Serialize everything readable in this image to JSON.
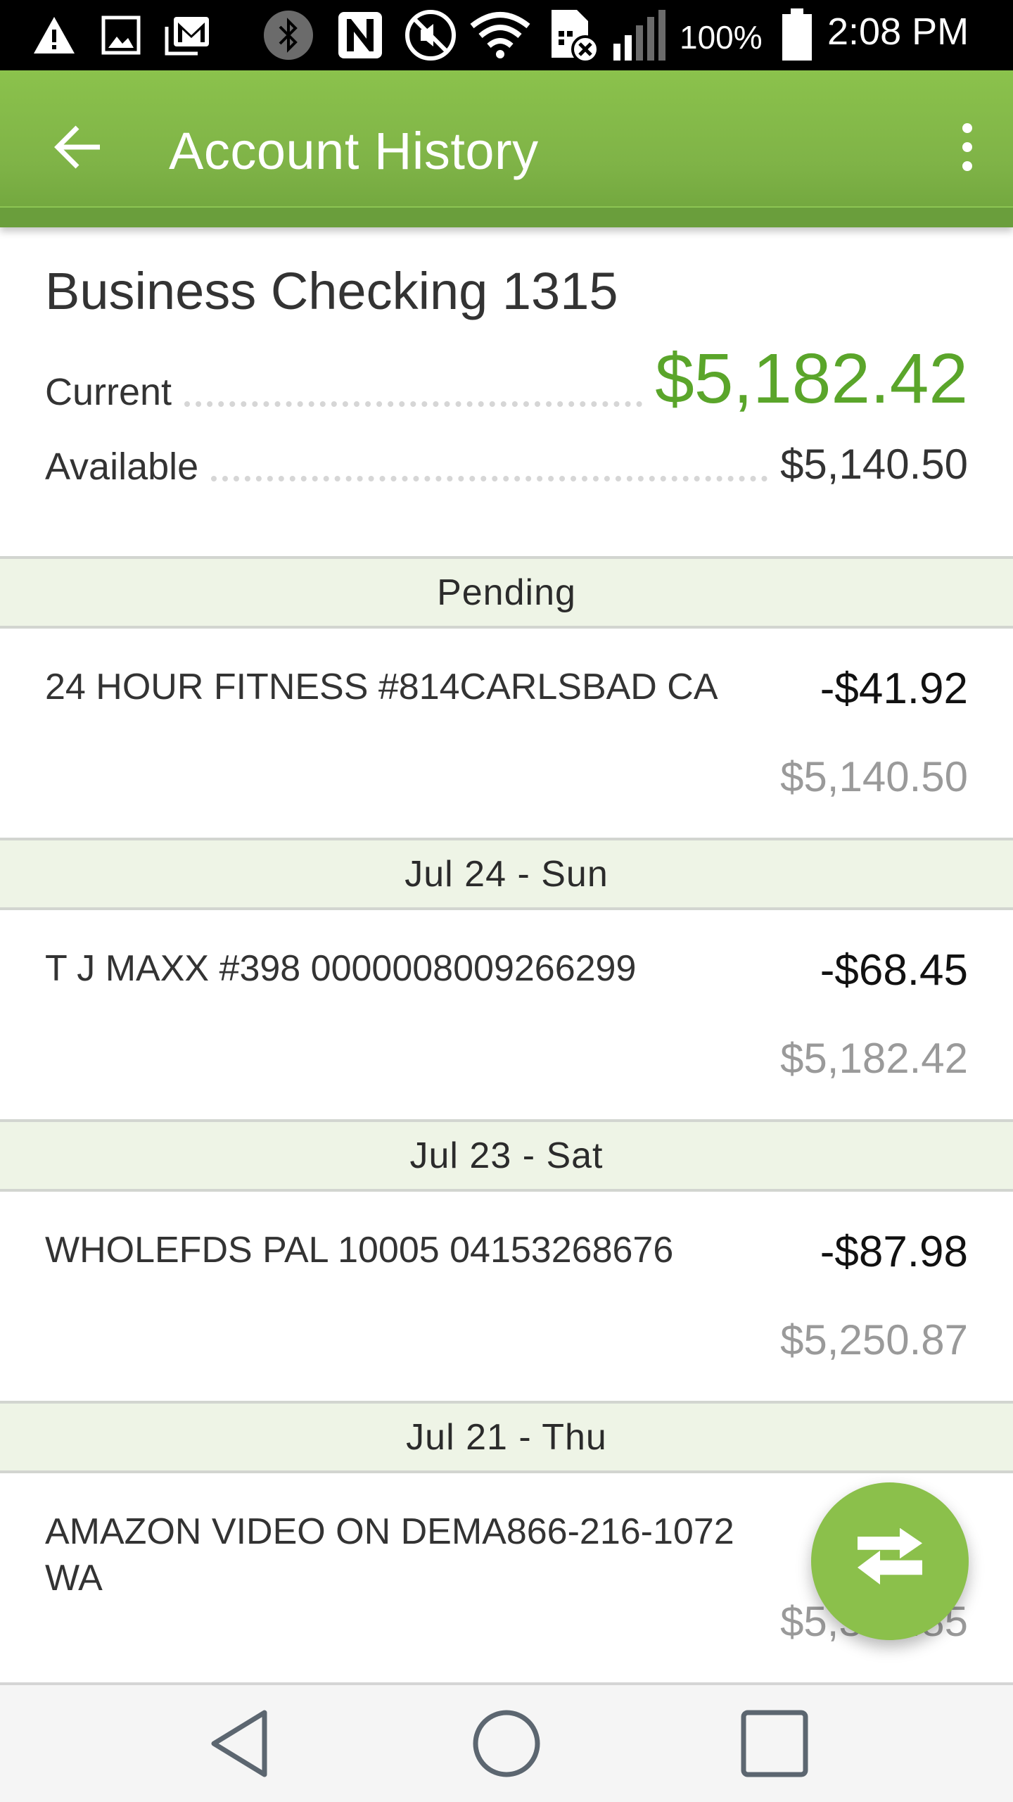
{
  "status_bar": {
    "battery_percent": "100%",
    "time": "2:08 PM",
    "icons": [
      "warning-icon",
      "image-icon",
      "gmail-icon",
      "bluetooth-icon",
      "nfc-icon",
      "mute-icon",
      "wifi-icon",
      "no-sim-icon",
      "signal-icon",
      "battery-icon"
    ]
  },
  "app_bar": {
    "title": "Account History",
    "back_icon": "arrow-left-icon",
    "menu_icon": "more-vert-icon"
  },
  "account": {
    "name": "Business Checking 1315",
    "current_label": "Current",
    "current_value": "$5,182.42",
    "available_label": "Available",
    "available_value": "$5,140.50"
  },
  "sections": [
    {
      "header": "Pending",
      "transactions": [
        {
          "description": "24 HOUR FITNESS #814CARLSBAD CA",
          "amount": "-$41.92",
          "balance": "$5,140.50"
        }
      ]
    },
    {
      "header": "Jul 24 - Sun",
      "transactions": [
        {
          "description": "T J MAXX #398 0000008009266299",
          "amount": "-$68.45",
          "balance": "$5,182.42"
        }
      ]
    },
    {
      "header": "Jul 23 - Sat",
      "transactions": [
        {
          "description": "WHOLEFDS PAL 10005 04153268676",
          "amount": "-$87.98",
          "balance": "$5,250.87"
        }
      ]
    },
    {
      "header": "Jul 21 - Thu",
      "transactions": [
        {
          "description": "AMAZON VIDEO ON DEMA866-216-1072 WA",
          "amount": "",
          "balance": "$5,338.85"
        }
      ]
    }
  ],
  "fab": {
    "icon": "transfer-icon",
    "label": "Transfer"
  },
  "colors": {
    "brand_green": "#8bc24c",
    "balance_green": "#5aa52a",
    "section_bg": "#eef4e6",
    "running_balance_gray": "#9a9a9a"
  },
  "nav_bar": {
    "buttons": [
      "back",
      "home",
      "recents"
    ]
  }
}
